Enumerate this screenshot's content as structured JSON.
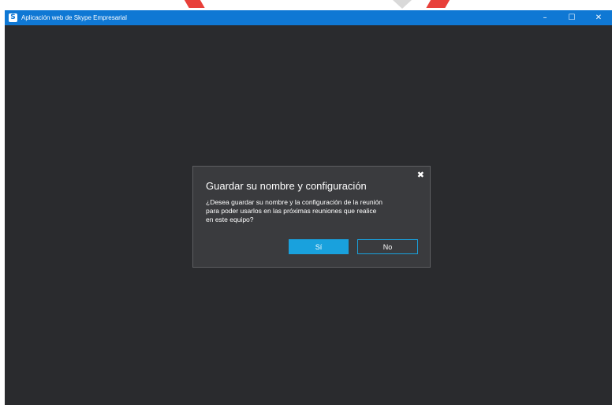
{
  "window": {
    "title": "Aplicación web de Skype Empresarial",
    "app_icon_letter": "S",
    "controls": {
      "minimize": "–",
      "maximize": "☐",
      "close": "✕"
    }
  },
  "dialog": {
    "title": "Guardar su nombre y configuración",
    "message_lines": [
      "¿Desea guardar su nombre y la configuración de la reunión",
      "para poder usarlos en las próximas reuniones que realice",
      "en este equipo?"
    ],
    "close_glyph": "✖",
    "yes_label": "Sí",
    "no_label": "No"
  },
  "colors": {
    "titlebar": "#0f78d4",
    "background": "#2a2b2e",
    "dialog": "#3a3b3e",
    "accent": "#19a1dd"
  },
  "icons": {
    "app": "skype-icon",
    "dialog_close": "close-icon"
  }
}
